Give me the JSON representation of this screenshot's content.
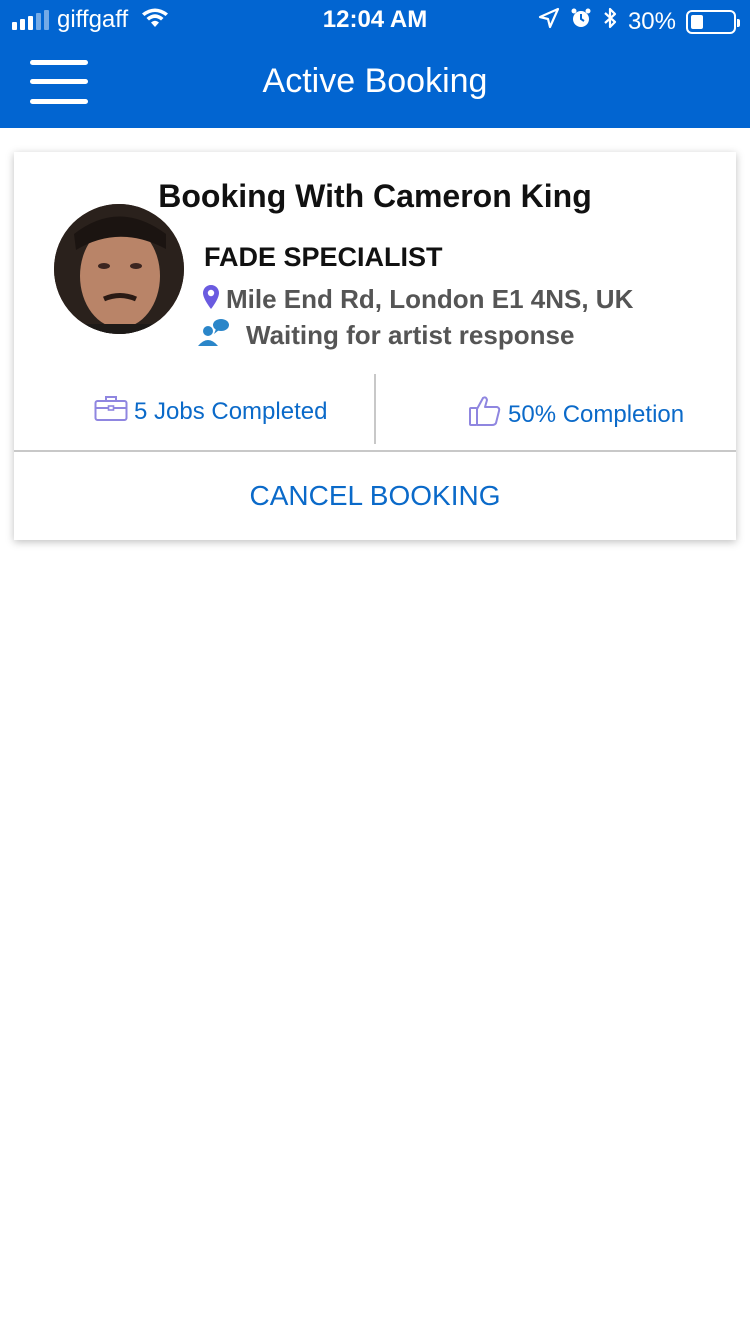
{
  "status_bar": {
    "carrier": "giffgaff",
    "time": "12:04 AM",
    "battery_percent": "30%",
    "battery_level": 0.3,
    "icons": [
      "signal-icon",
      "wifi-icon",
      "location-arrow-icon",
      "alarm-icon",
      "bluetooth-icon",
      "battery-icon"
    ]
  },
  "header": {
    "title": "Active Booking",
    "menu_icon": "hamburger-icon"
  },
  "booking": {
    "title": "Booking With Cameron King",
    "specialty": "FADE SPECIALIST",
    "address": "Mile End Rd, London E1 4NS, UK",
    "status": "Waiting for artist response",
    "jobs_completed": "5 Jobs Completed",
    "completion": "50% Completion",
    "cancel_label": "CANCEL BOOKING"
  },
  "colors": {
    "primary": "#0265d1",
    "link": "#0b6ac9",
    "text_secondary": "#555555",
    "pin": "#6a5be0",
    "icon_purple": "#8f86e0"
  }
}
